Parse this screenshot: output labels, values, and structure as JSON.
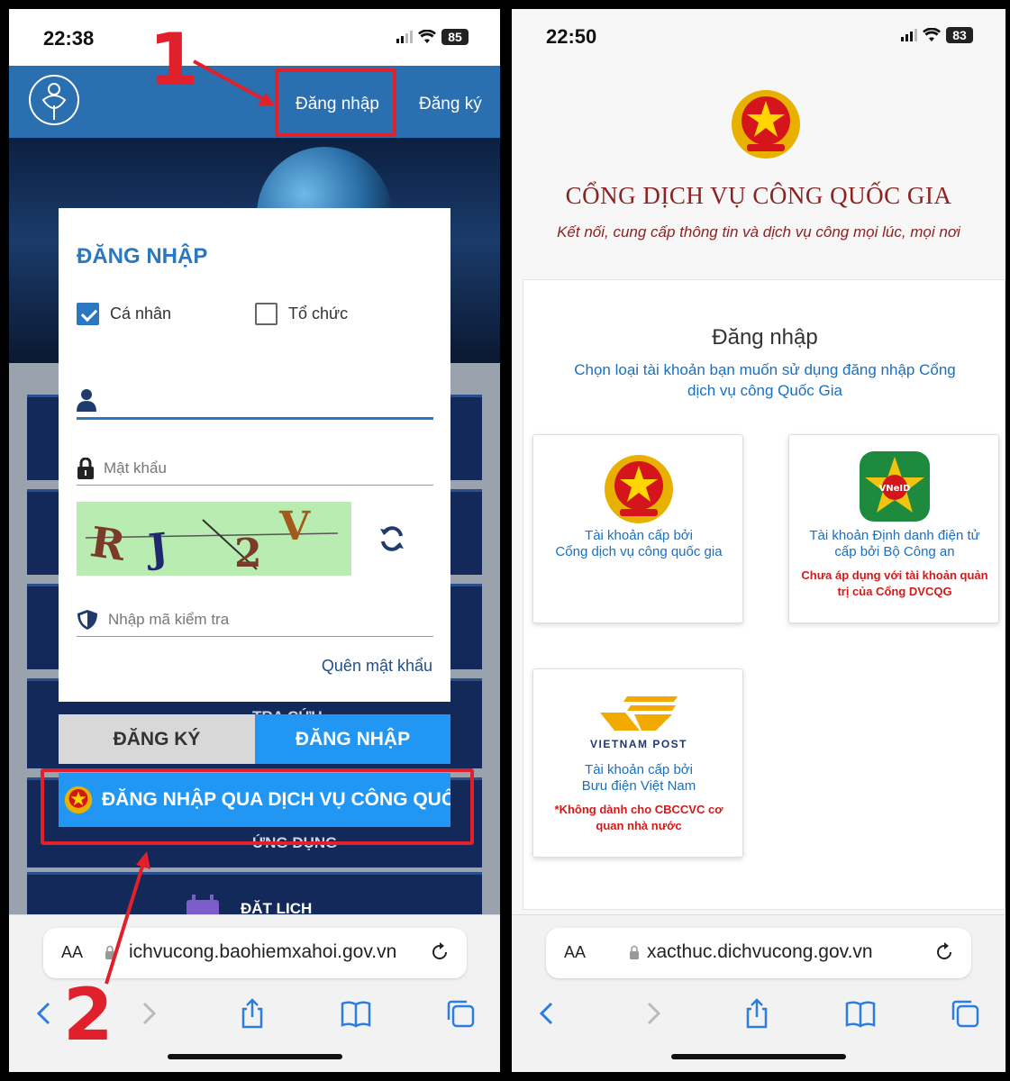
{
  "left": {
    "status": {
      "time": "22:38",
      "battery": "85"
    },
    "header": {
      "login": "Đăng nhập",
      "register": "Đăng ký"
    },
    "background": {
      "lookup": "TRA CỨU",
      "app": "ỨNG DỤNG",
      "booking": "ĐẶT LỊCH"
    },
    "login_form": {
      "title": "ĐĂNG NHẬP",
      "individual": "Cá nhân",
      "organization": "Tổ chức",
      "password_placeholder": "Mật khẩu",
      "captcha_text": "RJ2V",
      "code_placeholder": "Nhập mã kiểm tra",
      "forgot": "Quên mật khẩu",
      "register_button": "ĐĂNG KÝ",
      "login_button": "ĐĂNG NHẬP",
      "national_login_button": "ĐĂNG NHẬP QUA DỊCH VỤ CÔNG QUỐ"
    },
    "browser": {
      "aa": "AA",
      "url": "ichvucong.baohiemxahoi.gov.vn"
    },
    "annotations": {
      "one": "1",
      "two": "2"
    }
  },
  "right": {
    "status": {
      "time": "22:50",
      "battery": "83"
    },
    "portal": {
      "title": "CỔNG DỊCH VỤ CÔNG QUỐC GIA",
      "subtitle": "Kết nối, cung cấp thông tin và dịch vụ công mọi lúc, mọi nơi"
    },
    "login": {
      "title": "Đăng nhập",
      "description": "Chọn loại tài khoản bạn muốn sử dụng đăng nhập Cổng dịch vụ công Quốc Gia",
      "options": [
        {
          "label_1": "Tài khoản cấp bởi",
          "label_2": "Cổng dịch vụ công quốc gia",
          "warning": ""
        },
        {
          "label_1": "Tài khoản Định danh điện tử",
          "label_2": "cấp bởi Bộ Công an",
          "warning": "Chưa áp dụng với tài khoản quản trị của Cổng DVCQG",
          "badge": "VNeID"
        },
        {
          "label_1": "Tài khoản cấp bởi",
          "label_2": "Bưu điện Việt Nam",
          "warning": "*Không dành cho CBCCVC cơ quan nhà nước",
          "brand": "VIETNAM POST"
        }
      ]
    },
    "browser": {
      "aa": "AA",
      "url": "xacthuc.dichvucong.gov.vn"
    }
  },
  "colors": {
    "brand_blue": "#2196f3",
    "header_blue": "#2a6fb0",
    "annotation_red": "#e0202a",
    "portal_red": "#8b2323",
    "link_blue": "#1b6fc0"
  }
}
